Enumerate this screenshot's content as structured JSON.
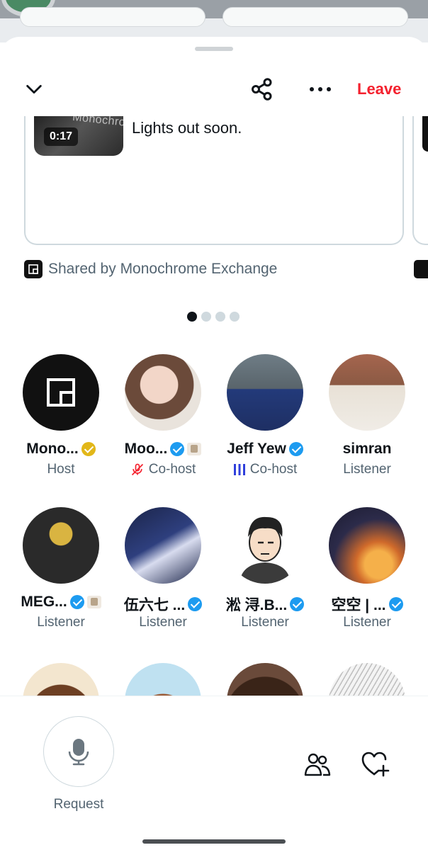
{
  "header": {
    "leave_label": "Leave"
  },
  "shared_post": {
    "duration": "0:17",
    "thumbnail_text": "Monochrome",
    "text": "Lights out soon.",
    "shared_by": "Shared by Monochrome Exchange"
  },
  "carousel": {
    "total": 4,
    "active": 1
  },
  "participants": [
    {
      "name": "Mono...",
      "role": "Host",
      "badge": "gold",
      "affiliate": false,
      "role_icon": ""
    },
    {
      "name": "Moo...",
      "role": "Co-host",
      "badge": "blue",
      "affiliate": true,
      "role_icon": "mic-off-icon"
    },
    {
      "name": "Jeff Yew",
      "role": "Co-host",
      "badge": "blue",
      "affiliate": false,
      "role_icon": "speaking-icon"
    },
    {
      "name": "simran",
      "role": "Listener",
      "badge": "",
      "affiliate": false,
      "role_icon": ""
    },
    {
      "name": "MEG...",
      "role": "Listener",
      "badge": "blue",
      "affiliate": true,
      "role_icon": ""
    },
    {
      "name": "伍六七 ...",
      "role": "Listener",
      "badge": "blue",
      "affiliate": false,
      "role_icon": ""
    },
    {
      "name": "淞 浔.B...",
      "role": "Listener",
      "badge": "blue",
      "affiliate": false,
      "role_icon": ""
    },
    {
      "name": "空空 | ...",
      "role": "Listener",
      "badge": "blue",
      "affiliate": false,
      "role_icon": ""
    }
  ],
  "bottom_bar": {
    "request_label": "Request"
  },
  "colors": {
    "leave": "#f4212e",
    "verified": "#1d9bf0",
    "gold": "#e2b719",
    "speaking": "#2f3fdb",
    "muted": "#f4212e",
    "secondary_text": "#536471"
  }
}
